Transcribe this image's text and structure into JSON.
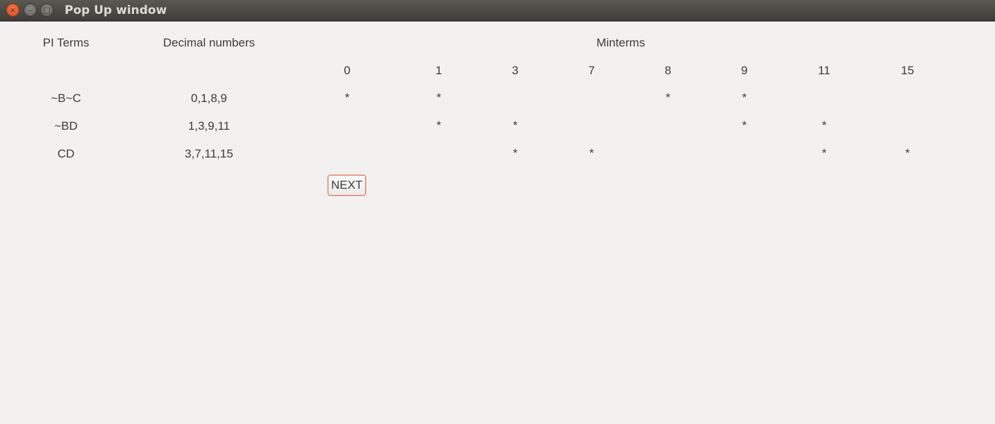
{
  "window": {
    "title": "Pop Up window",
    "close_glyph": "×",
    "min_glyph": "–",
    "max_glyph": "□"
  },
  "headers": {
    "pi_terms": "PI Terms",
    "decimal_numbers": "Decimal numbers",
    "minterms": "Minterms"
  },
  "minterm_columns": [
    "0",
    "1",
    "3",
    "7",
    "8",
    "9",
    "11",
    "15"
  ],
  "rows": [
    {
      "term": "~B~C",
      "decimals": "0,1,8,9",
      "marks": [
        "*",
        "*",
        "",
        "",
        "*",
        "*",
        "",
        ""
      ]
    },
    {
      "term": "~BD",
      "decimals": "1,3,9,11",
      "marks": [
        "",
        "*",
        "*",
        "",
        "",
        "*",
        "*",
        ""
      ]
    },
    {
      "term": "CD",
      "decimals": "3,7,11,15",
      "marks": [
        "",
        "",
        "*",
        "*",
        "",
        "",
        "*",
        "*"
      ]
    }
  ],
  "buttons": {
    "next": "NEXT"
  }
}
